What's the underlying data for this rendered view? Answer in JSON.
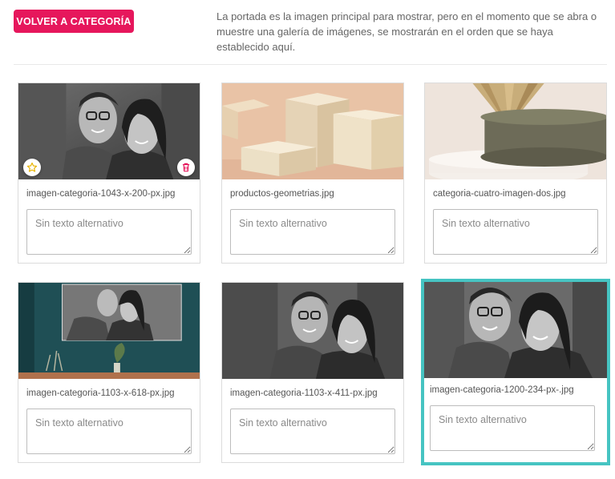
{
  "header": {
    "back_button_label": "VOLVER A CATEGORÍA",
    "intro_text": "La portada es la imagen principal para mostrar, pero en el momento que se abra o muestre una galería de imágenes, se mostrarán en el orden que se haya establecido aquí."
  },
  "colors": {
    "accent": "#e6175c",
    "selected_border": "#46c4c2",
    "star": "#e8b400",
    "trash": "#e6175c"
  },
  "gallery": {
    "items": [
      {
        "filename": "imagen-categoria-1043-x-200-px.jpg",
        "alt_placeholder": "Sin texto alternativo",
        "image": "couple-photo-bw",
        "is_cover": true,
        "selected": false
      },
      {
        "filename": "productos-geometrias.jpg",
        "alt_placeholder": "Sin texto alternativo",
        "image": "beige-geometric-blocks",
        "selected": false
      },
      {
        "filename": "categoria-cuatro-imagen-dos.jpg",
        "alt_placeholder": "Sin texto alternativo",
        "image": "olive-cylinder-podium",
        "selected": false
      },
      {
        "filename": "imagen-categoria-1103-x-618-px.jpg",
        "alt_placeholder": "Sin texto alternativo",
        "image": "couple-photo-on-teal-wall",
        "selected": false
      },
      {
        "filename": "imagen-categoria-1103-x-411-px.jpg",
        "alt_placeholder": "Sin texto alternativo",
        "image": "couple-photo-bw",
        "selected": false
      },
      {
        "filename": "imagen-categoria-1200-234-px-.jpg",
        "alt_placeholder": "Sin texto alternativo",
        "image": "couple-photo-bw",
        "selected": true
      }
    ]
  },
  "icons": {
    "cover_star": "star-icon",
    "delete": "trash-icon"
  }
}
